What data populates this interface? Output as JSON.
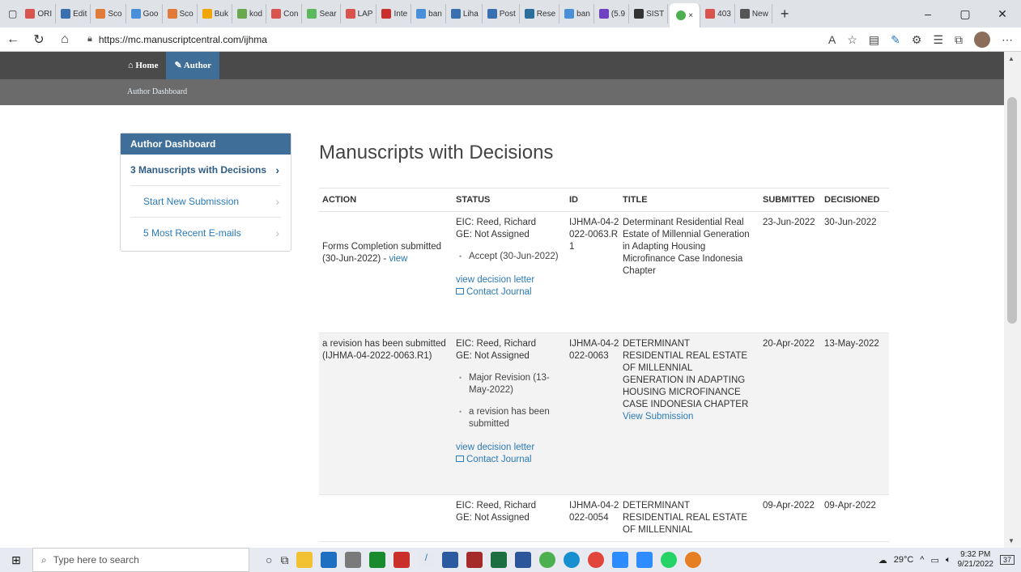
{
  "browser": {
    "tabs": [
      {
        "label": "ORI",
        "color": "#d9534f"
      },
      {
        "label": "Edit",
        "color": "#3a6fb0"
      },
      {
        "label": "Sco",
        "color": "#e07b39"
      },
      {
        "label": "Goo",
        "color": "#4a90d9"
      },
      {
        "label": "Sco",
        "color": "#e07b39"
      },
      {
        "label": "Buk",
        "color": "#f0a500"
      },
      {
        "label": "kod",
        "color": "#6aa84f"
      },
      {
        "label": "Con",
        "color": "#d9534f"
      },
      {
        "label": "Sear",
        "color": "#5cb85c"
      },
      {
        "label": "LAP",
        "color": "#d9534f"
      },
      {
        "label": "Inte",
        "color": "#c9302c"
      },
      {
        "label": "ban",
        "color": "#4a90d9"
      },
      {
        "label": "Liha",
        "color": "#3a6fb0"
      },
      {
        "label": "Post",
        "color": "#3a6fb0"
      },
      {
        "label": "Rese",
        "color": "#2c6e9b"
      },
      {
        "label": "ban",
        "color": "#4a90d9"
      },
      {
        "label": "(5.9",
        "color": "#6f42c1"
      },
      {
        "label": "SIST",
        "color": "#333333"
      }
    ],
    "active_tab_close": "×",
    "after_tabs": [
      {
        "label": "403",
        "color": "#d9534f"
      },
      {
        "label": "New",
        "color": "#555555"
      }
    ],
    "new_tab_plus": "+",
    "window": {
      "minimize": "–",
      "restore": "▢",
      "close": "✕"
    },
    "url": "https://mc.manuscriptcentral.com/ijhma"
  },
  "site": {
    "nav": {
      "home": "Home",
      "author": "Author"
    },
    "subnav": "Author Dashboard"
  },
  "sidebar": {
    "header": "Author Dashboard",
    "items": [
      {
        "label": "3  Manuscripts with Decisions",
        "selected": true
      },
      {
        "label": "Start New Submission",
        "selected": false
      },
      {
        "label": "5 Most Recent E-mails",
        "selected": false
      }
    ]
  },
  "main": {
    "title": "Manuscripts with Decisions",
    "columns": [
      "ACTION",
      "STATUS",
      "ID",
      "TITLE",
      "SUBMITTED",
      "DECISIONED"
    ],
    "rows": [
      {
        "action_text": "Forms Completion submitted (30-Jun-2022) - ",
        "action_link": "view",
        "status_lines": [
          "EIC: Reed, Richard",
          "GE: Not Assigned"
        ],
        "status_bullets": [
          "Accept (30-Jun-2022)"
        ],
        "status_links": [
          "view decision letter",
          "Contact Journal"
        ],
        "id": "IJHMA-04-2022-0063.R1",
        "title": "Determinant Residential Real Estate of Millennial Generation in Adapting Housing Microfinance Case Indonesia Chapter",
        "title_link": "",
        "submitted": "23-Jun-2022",
        "decisioned": "30-Jun-2022"
      },
      {
        "action_text": "a revision has been submitted (IJHMA-04-2022-0063.R1)",
        "action_link": "",
        "status_lines": [
          "EIC: Reed, Richard",
          "GE: Not Assigned"
        ],
        "status_bullets": [
          "Major Revision (13-May-2022)",
          "a revision has been submitted"
        ],
        "status_links": [
          "view decision letter",
          "Contact Journal"
        ],
        "id": "IJHMA-04-2022-0063",
        "title": "DETERMINANT RESIDENTIAL REAL ESTATE OF MILLENNIAL GENERATION IN ADAPTING HOUSING MICROFINANCE CASE INDONESIA CHAPTER",
        "title_link": "View Submission",
        "submitted": "20-Apr-2022",
        "decisioned": "13-May-2022"
      },
      {
        "action_text": "",
        "action_link": "",
        "status_lines": [
          "EIC: Reed, Richard",
          "GE: Not Assigned"
        ],
        "status_bullets": [],
        "status_links": [],
        "id": "IJHMA-04-2022-0054",
        "title": "DETERMINANT RESIDENTIAL REAL ESTATE OF MILLENNIAL",
        "title_link": "",
        "submitted": "09-Apr-2022",
        "decisioned": "09-Apr-2022"
      }
    ]
  },
  "taskbar": {
    "search_placeholder": "Type here to search",
    "weather": "29°C",
    "time": "9:32 PM",
    "date": "9/21/2022",
    "notifications": "37"
  }
}
